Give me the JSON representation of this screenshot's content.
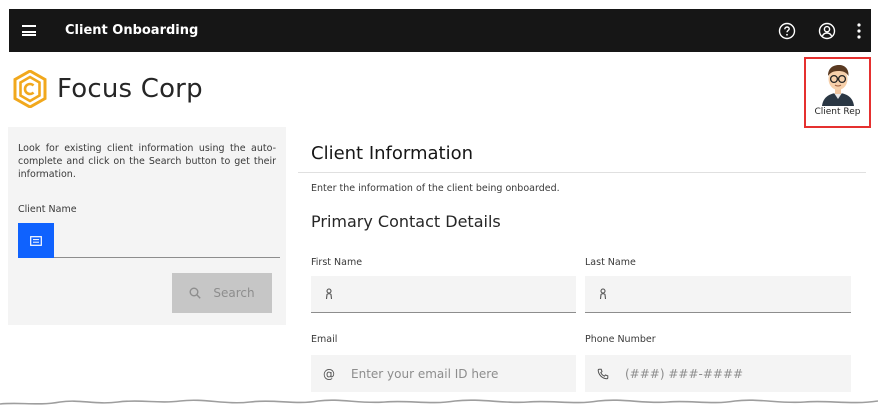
{
  "header": {
    "app_title": "Client Onboarding",
    "icons": [
      "menu-icon",
      "help-icon",
      "user-profile-icon",
      "overflow-menu-icon"
    ]
  },
  "brand": {
    "name": "Focus Corp",
    "logo_color": "#f1a81d"
  },
  "user": {
    "role_label": "Client Rep",
    "highlight_color": "#e5302f"
  },
  "lookup": {
    "description": "Look for existing client information using the auto-complete and click on the Search button to get their information.",
    "client_name_label": "Client Name",
    "search_label": "Search"
  },
  "client_info": {
    "title": "Client Information",
    "description": "Enter the information of the client being onboarded.",
    "section_title": "Primary Contact Details",
    "fields": {
      "first_name": {
        "label": "First Name",
        "placeholder": ""
      },
      "last_name": {
        "label": "Last Name",
        "placeholder": ""
      },
      "email": {
        "label": "Email",
        "placeholder": "Enter your email ID here"
      },
      "phone": {
        "label": "Phone Number",
        "placeholder": "(###) ###-####"
      }
    }
  },
  "colors": {
    "topbar": "#161616",
    "accent": "#0f62fe",
    "panel": "#f4f4f4"
  }
}
